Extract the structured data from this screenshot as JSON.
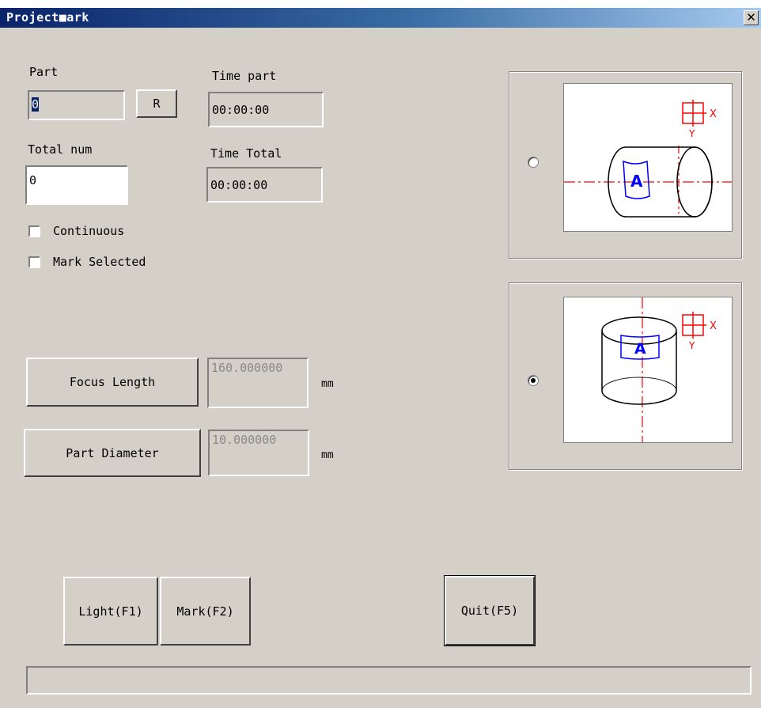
{
  "window": {
    "title": "Project■ark",
    "close_symbol": "✕"
  },
  "fields": {
    "part_label": "Part",
    "part_value": "0",
    "reset_button": "R",
    "time_part_label": "Time part",
    "time_part_value": "00:00:00",
    "total_num_label": "Total num",
    "total_num_value": "0",
    "time_total_label": "Time Total",
    "time_total_value": "00:00:00"
  },
  "options": {
    "continuous_label": "Continuous",
    "continuous_checked": false,
    "mark_selected_label": "Mark Selected",
    "mark_selected_checked": false
  },
  "params": {
    "focus_length_button": "Focus Length",
    "focus_length_value": "160.000000",
    "focus_length_unit": "mm",
    "part_diameter_button": "Part Diameter",
    "part_diameter_value": "10.000000",
    "part_diameter_unit": "mm"
  },
  "diagrams": {
    "axis_x_label": "X",
    "axis_y_label": "Y",
    "marking_letter": "A",
    "horizontal_selected": false,
    "vertical_selected": true
  },
  "actions": {
    "light_button": "Light(F1)",
    "mark_button": "Mark(F2)",
    "quit_button": "Quit(F5)"
  },
  "status": {
    "progress": 0
  },
  "colors": {
    "title_start": "#0a246a",
    "title_end": "#a6caf0",
    "dialog_bg": "#d4d0c8",
    "axis_red": "#ff0000",
    "mark_blue": "#0000ff"
  }
}
